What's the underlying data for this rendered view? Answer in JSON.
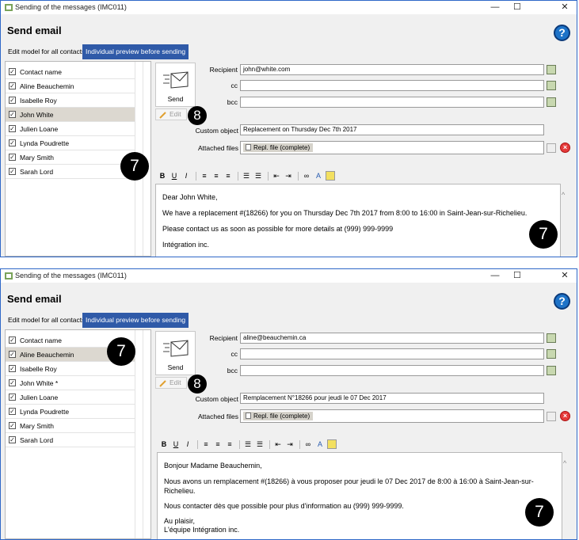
{
  "screens": [
    {
      "window_title": "Sending of the messages (IMC011)",
      "heading": "Send email",
      "help_symbol": "?",
      "tabs": [
        "Edit model for all contacts",
        "Individual preview before sending"
      ],
      "contacts_header": "Contact name",
      "contacts": [
        "Aline Beauchemin",
        "Isabelle Roy",
        "John White",
        "Julien Loane",
        "Lynda Poudrette",
        "Mary Smith",
        "Sarah Lord"
      ],
      "selected_contact": "John White",
      "send_label": "Send",
      "edit_label": "Edit",
      "recipient_label": "Recipient",
      "recipient": "john@white.com",
      "cc_label": "cc",
      "cc": "",
      "bcc_label": "bcc",
      "bcc": "",
      "subject_label": "Custom object",
      "subject": "Replacement on Thursday Dec 7th 2017",
      "attached_label": "Attached files",
      "attachment": "Repl. file (complete)",
      "body": [
        "Dear John White,",
        "We have a replacement #(18266) for you on Thursday Dec 7th 2017 from 8:00 to 16:00 in Saint-Jean-sur-Richelieu.",
        "Please contact us as soon as possible for more details at (999) 999-9999",
        "Intégration inc."
      ],
      "callouts": [
        "8",
        "7",
        "7"
      ]
    },
    {
      "window_title": "Sending of the messages (IMC011)",
      "heading": "Send email",
      "help_symbol": "?",
      "tabs": [
        "Edit model for all contacts",
        "Individual preview before sending"
      ],
      "contacts_header": "Contact name",
      "contacts": [
        "Aline Beauchemin",
        "Isabelle Roy",
        "John White *",
        "Julien Loane",
        "Lynda Poudrette",
        "Mary Smith",
        "Sarah Lord"
      ],
      "selected_contact": "Aline Beauchemin",
      "send_label": "Send",
      "edit_label": "Edit",
      "recipient_label": "Recipient",
      "recipient": "aline@beauchemin.ca",
      "cc_label": "cc",
      "cc": "",
      "bcc_label": "bcc",
      "bcc": "",
      "subject_label": "Custom object",
      "subject": "Remplacement N°18266 pour jeudi  le 07 Dec 2017",
      "attached_label": "Attached files",
      "attachment": "Repl. file (complete)",
      "body": [
        "Bonjour Madame Beauchemin,",
        "Nous avons un remplacement #(18266) à vous proposer pour jeudi le 07 Dec 2017 de 8:00 à 16:00 à Saint-Jean-sur-",
        "Richelieu.",
        "Nous contacter dès que possible pour plus d'information au (999) 999-9999.",
        "Au plaisir,",
        "L'équipe Intégration inc."
      ],
      "callouts": [
        "7",
        "8",
        "7"
      ]
    }
  ],
  "window_controls": [
    "—",
    "☐",
    "✕"
  ],
  "toolbar_glyphs": [
    "B",
    "U",
    "I"
  ],
  "colors": {
    "tab_active": "#2f5aa8",
    "help": "#1e73c8",
    "delete": "#e53a3a",
    "selected_row": "#dcd8d0"
  }
}
